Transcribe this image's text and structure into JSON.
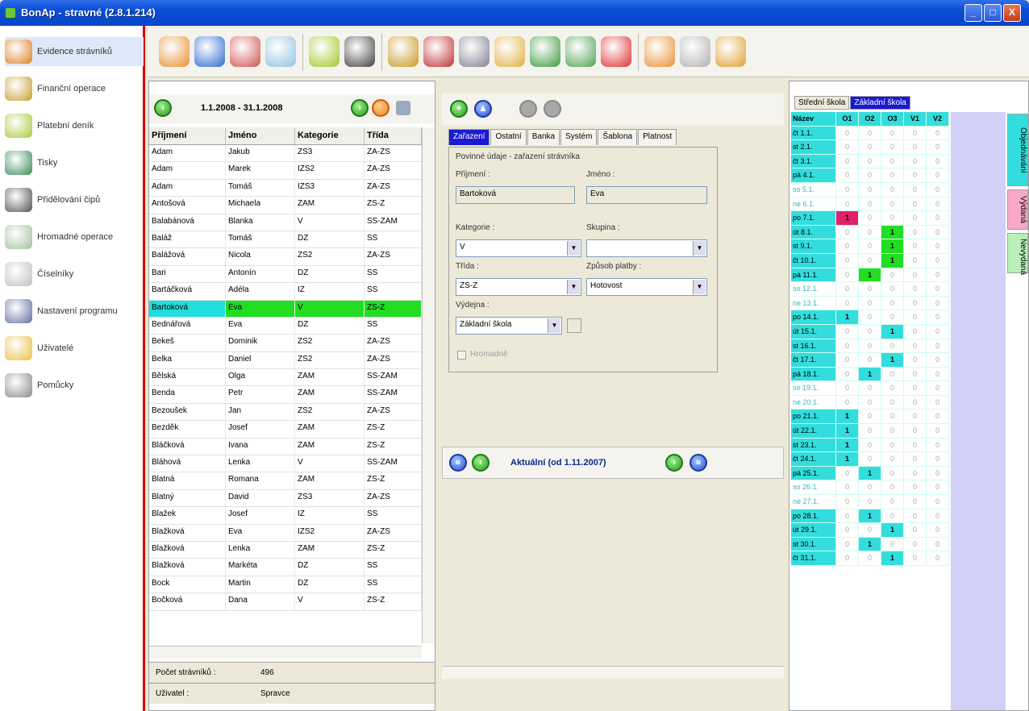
{
  "window": {
    "title": "BonAp - stravné (2.8.1.214)",
    "min": "_",
    "max": "□",
    "close": "X"
  },
  "nav": [
    {
      "label": "Evidence strávníků",
      "icon": "people-icon",
      "color": "#e08020"
    },
    {
      "label": "Finanční operace",
      "icon": "moneybag-icon",
      "color": "#c8a030"
    },
    {
      "label": "Platební deník",
      "icon": "book-icon",
      "color": "#a8c838"
    },
    {
      "label": "Tisky",
      "icon": "printer-icon",
      "color": "#3a8a5a"
    },
    {
      "label": "Přidělování čipů",
      "icon": "chip-icon",
      "color": "#505050"
    },
    {
      "label": "Hromadné operace",
      "icon": "coins-icon",
      "color": "#a0c0a0"
    },
    {
      "label": "Číselníky",
      "icon": "gear-icon",
      "color": "#c0c0c0"
    },
    {
      "label": "Nastavení programu",
      "icon": "cube-icon",
      "color": "#6070a0"
    },
    {
      "label": "Uživatelé",
      "icon": "padlock-icon",
      "color": "#e8c040"
    },
    {
      "label": "Pomůcky",
      "icon": "tools-icon",
      "color": "#8a8a8a"
    }
  ],
  "toolbar": [
    {
      "icon": "people-icon",
      "color": "#e89030"
    },
    {
      "icon": "book-icon",
      "color": "#2a6ad0"
    },
    {
      "icon": "calendar-icon",
      "color": "#d05050"
    },
    {
      "icon": "envelope-icon",
      "color": "#90c0e0"
    },
    {
      "icon": "folder-icon",
      "color": "#a0c828"
    },
    {
      "icon": "chip-icon",
      "color": "#404040"
    },
    {
      "icon": "moneybag-icon",
      "color": "#c89820"
    },
    {
      "icon": "printer-icon",
      "color": "#c03030"
    },
    {
      "icon": "phone-icon",
      "color": "#808090"
    },
    {
      "icon": "key-icon",
      "color": "#e0b040"
    },
    {
      "icon": "books-icon",
      "color": "#3a9a3a"
    },
    {
      "icon": "pen-icon",
      "color": "#50a050"
    },
    {
      "icon": "lifebuoy-icon",
      "color": "#e03030"
    },
    {
      "icon": "users-icon",
      "color": "#e89030"
    },
    {
      "icon": "settings-icon",
      "color": "#b0b0b0"
    },
    {
      "icon": "edit-icon",
      "color": "#e0a030"
    }
  ],
  "list": {
    "date_range": "1.1.2008 - 31.1.2008",
    "columns": [
      "Příjmení",
      "Jméno",
      "Kategorie",
      "Třída"
    ],
    "rows": [
      [
        "Adam",
        "Jakub",
        "ZS3",
        "ZA-ZS"
      ],
      [
        "Adam",
        "Marek",
        "IZS2",
        "ZA-ZS"
      ],
      [
        "Adam",
        "Tomáš",
        "IZS3",
        "ZA-ZS"
      ],
      [
        "Antošová",
        "Michaela",
        "ZAM",
        "ZS-Z"
      ],
      [
        "Balabánová",
        "Blanka",
        "V",
        "SS-ZAM"
      ],
      [
        "Baláž",
        "Tomáš",
        "DZ",
        "SS"
      ],
      [
        "Balážová",
        "Nicola",
        "ZS2",
        "ZA-ZS"
      ],
      [
        "Bari",
        "Antonín",
        "DZ",
        "SS"
      ],
      [
        "Bartáčková",
        "Adéla",
        "IZ",
        "SS"
      ],
      [
        "Bartoková",
        "Eva",
        "V",
        "ZS-Z"
      ],
      [
        "Bednářová",
        "Eva",
        "DZ",
        "SS"
      ],
      [
        "Bekeš",
        "Dominik",
        "ZS2",
        "ZA-ZS"
      ],
      [
        "Belka",
        "Daniel",
        "ZS2",
        "ZA-ZS"
      ],
      [
        "Bělská",
        "Olga",
        "ZAM",
        "SS-ZAM"
      ],
      [
        "Benda",
        "Petr",
        "ZAM",
        "SS-ZAM"
      ],
      [
        "Bezoušek",
        "Jan",
        "ZS2",
        "ZA-ZS"
      ],
      [
        "Bezděk",
        "Josef",
        "ZAM",
        "ZS-Z"
      ],
      [
        "Bláčková",
        "Ivana",
        "ZAM",
        "ZS-Z"
      ],
      [
        "Bláhová",
        "Lenka",
        "V",
        "SS-ZAM"
      ],
      [
        "Blatná",
        "Romana",
        "ZAM",
        "ZS-Z"
      ],
      [
        "Blatný",
        "David",
        "ZS3",
        "ZA-ZS"
      ],
      [
        "Blažek",
        "Josef",
        "IZ",
        "SS"
      ],
      [
        "Blažková",
        "Eva",
        "IZS2",
        "ZA-ZS"
      ],
      [
        "Blažková",
        "Lenka",
        "ZAM",
        "ZS-Z"
      ],
      [
        "Blažková",
        "Markéta",
        "DZ",
        "SS"
      ],
      [
        "Bock",
        "Martin",
        "DZ",
        "SS"
      ],
      [
        "Bočková",
        "Dana",
        "V",
        "ZS-Z"
      ]
    ],
    "count_label": "Počet strávníků :",
    "count_value": "496",
    "user_label": "Uživatel :",
    "user_value": "Spravce"
  },
  "detail": {
    "tabs": [
      "Zařazení",
      "Ostatní",
      "Banka",
      "Systém",
      "Šablona",
      "Platnost"
    ],
    "group_title": "Povinné údaje - zařazení strávníka",
    "surname_label": "Příjmení :",
    "surname_value": "Bartoková",
    "name_label": "Jméno :",
    "name_value": "Eva",
    "category_label": "Kategorie :",
    "category_value": "V",
    "group_label": "Skupina :",
    "group_value": "",
    "class_label": "Třída :",
    "class_value": "ZS-Z",
    "payment_label": "Způsob platby :",
    "payment_value": "Hotovost",
    "canteen_label": "Výdejna :",
    "canteen_value": "Základní škola",
    "bulk_label": "Hromadně",
    "period_label": "Aktuální (od 1.11.2007)"
  },
  "calendar": {
    "tabs": [
      "Střední škola",
      "Základní škola"
    ],
    "headers": [
      "Název",
      "O1",
      "O2",
      "O3",
      "V1",
      "V2"
    ],
    "rows": [
      [
        "čt 1.1.",
        "0",
        "0",
        "0",
        "0",
        "0"
      ],
      [
        "st 2.1.",
        "0",
        "0",
        "0",
        "0",
        "0"
      ],
      [
        "čt 3.1.",
        "0",
        "0",
        "0",
        "0",
        "0"
      ],
      [
        "pá 4.1.",
        "0",
        "0",
        "0",
        "0",
        "0"
      ],
      [
        "so 5.1.",
        "0",
        "0",
        "0",
        "0",
        "0"
      ],
      [
        "ne 6.1.",
        "0",
        "0",
        "0",
        "0",
        "0"
      ],
      [
        "po 7.1.",
        "1",
        "0",
        "0",
        "0",
        "0"
      ],
      [
        "út 8.1.",
        "0",
        "0",
        "1",
        "0",
        "0"
      ],
      [
        "st 9.1.",
        "0",
        "0",
        "1",
        "0",
        "0"
      ],
      [
        "čt 10.1.",
        "0",
        "0",
        "1",
        "0",
        "0"
      ],
      [
        "pá 11.1.",
        "0",
        "1",
        "0",
        "0",
        "0"
      ],
      [
        "so 12.1.",
        "0",
        "0",
        "0",
        "0",
        "0"
      ],
      [
        "ne 13.1.",
        "0",
        "0",
        "0",
        "0",
        "0"
      ],
      [
        "po 14.1.",
        "1",
        "0",
        "0",
        "0",
        "0"
      ],
      [
        "út 15.1.",
        "0",
        "0",
        "1",
        "0",
        "0"
      ],
      [
        "st 16.1.",
        "0",
        "0",
        "0",
        "0",
        "0"
      ],
      [
        "čt 17.1.",
        "0",
        "0",
        "1",
        "0",
        "0"
      ],
      [
        "pá 18.1.",
        "0",
        "1",
        "0",
        "0",
        "0"
      ],
      [
        "so 19.1.",
        "0",
        "0",
        "0",
        "0",
        "0"
      ],
      [
        "ne 20.1.",
        "0",
        "0",
        "0",
        "0",
        "0"
      ],
      [
        "po 21.1.",
        "1",
        "0",
        "0",
        "0",
        "0"
      ],
      [
        "út 22.1.",
        "1",
        "0",
        "0",
        "0",
        "0"
      ],
      [
        "st 23.1.",
        "1",
        "0",
        "0",
        "0",
        "0"
      ],
      [
        "čt 24.1.",
        "1",
        "0",
        "0",
        "0",
        "0"
      ],
      [
        "pá 25.1.",
        "0",
        "1",
        "0",
        "0",
        "0"
      ],
      [
        "so 26.1.",
        "0",
        "0",
        "0",
        "0",
        "0"
      ],
      [
        "ne 27.1.",
        "0",
        "0",
        "0",
        "0",
        "0"
      ],
      [
        "po 28.1.",
        "0",
        "1",
        "0",
        "0",
        "0"
      ],
      [
        "út 29.1.",
        "0",
        "0",
        "1",
        "0",
        "0"
      ],
      [
        "st 30.1.",
        "0",
        "1",
        "0",
        "0",
        "0"
      ],
      [
        "čt 31.1.",
        "0",
        "0",
        "1",
        "0",
        "0"
      ]
    ],
    "side_tabs": [
      "Objednávání",
      "Výdaná",
      "Nevydaná"
    ],
    "side_colors": [
      "#33dddd",
      "#f8a8c8",
      "#b8f0b8"
    ],
    "highlight_colors": {
      "pink": "#e0206a",
      "green": "#22dd22",
      "cyan": "#33dddd"
    }
  }
}
